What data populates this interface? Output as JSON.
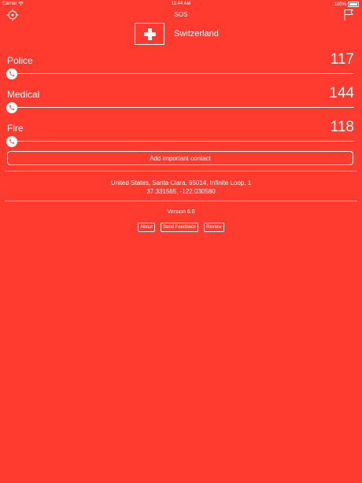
{
  "status": {
    "carrier": "Carrier",
    "time": "11:44 AM",
    "battery": "100%"
  },
  "nav": {
    "title": "SOS",
    "left_icon": "locate-icon",
    "right_icon": "flag-icon"
  },
  "country": {
    "name": "Switzerland",
    "flag": "swiss-flag"
  },
  "services": [
    {
      "label": "Police",
      "number": "117"
    },
    {
      "label": "Medical",
      "number": "144"
    },
    {
      "label": "Fire",
      "number": "118"
    }
  ],
  "add_contact_label": "Add important contact",
  "location": {
    "address": "United States, Santa Clara, 95014, Infinite Loop, 1",
    "coordinates": "37.331565, -122.030580"
  },
  "version": "Version 6.0",
  "links": {
    "about": "About",
    "feedback": "Send Feedback",
    "review": "Review"
  },
  "colors": {
    "background": "#ff3b30",
    "foreground": "#ffffff"
  }
}
